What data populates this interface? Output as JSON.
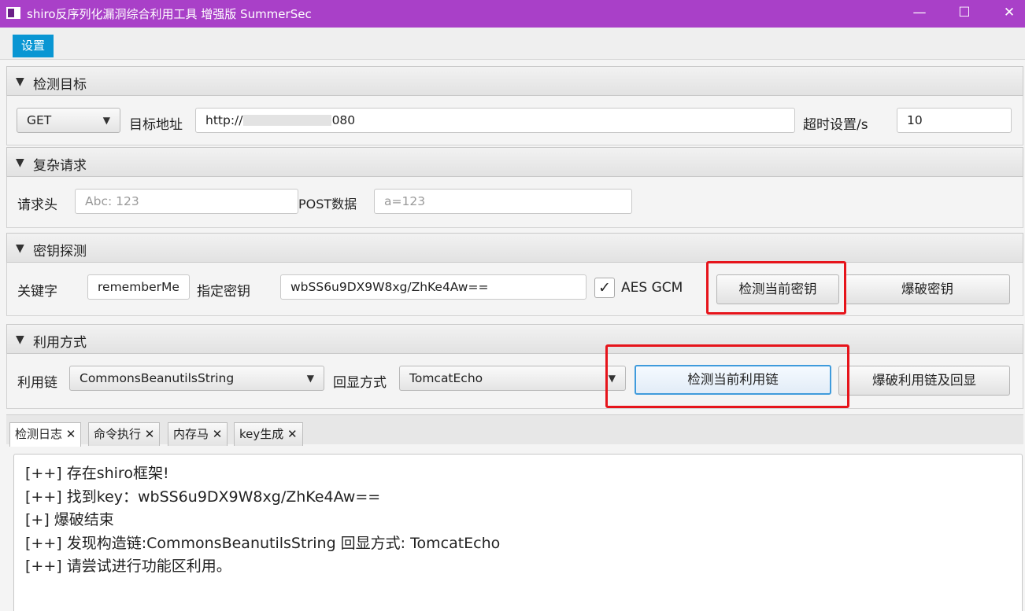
{
  "window": {
    "title": "shiro反序列化漏洞综合利用工具 增强版 SummerSec",
    "minimize": "—",
    "maximize": "☐",
    "close": "✕"
  },
  "menu": {
    "settings": "设置"
  },
  "target": {
    "header": "检测目标",
    "method": "GET",
    "url_label": "目标地址",
    "url_prefix": "http://",
    "url_suffix": ":8080",
    "timeout_label": "超时设置/s",
    "timeout_value": "10"
  },
  "complex": {
    "header": "复杂请求",
    "headers_label": "请求头",
    "headers_placeholder": "Abc: 123",
    "post_label": "POST数据",
    "post_placeholder": "a=123"
  },
  "key": {
    "header": "密钥探测",
    "keyword_label": "关键字",
    "keyword_value": "rememberMe",
    "key_label": "指定密钥",
    "key_value": "wbSS6u9DX9W8xg/ZhKe4Aw==",
    "aes_gcm_label": "AES GCM",
    "check_key_button": "检测当前密钥",
    "brute_key_button": "爆破密钥"
  },
  "exploit": {
    "header": "利用方式",
    "chain_label": "利用链",
    "chain_value": "CommonsBeanutilsString",
    "echo_label": "回显方式",
    "echo_value": "TomcatEcho",
    "check_chain_button": "检测当前利用链",
    "brute_chain_button": "爆破利用链及回显"
  },
  "tabs": [
    {
      "label": "检测日志"
    },
    {
      "label": "命令执行"
    },
    {
      "label": "内存马"
    },
    {
      "label": "key生成"
    }
  ],
  "log": [
    "[++] 存在shiro框架!",
    "[++] 找到key：wbSS6u9DX9W8xg/ZhKe4Aw==",
    "[+] 爆破结束",
    "[++] 发现构造链:CommonsBeanutilsString  回显方式: TomcatEcho",
    "[++] 请尝试进行功能区利用。"
  ]
}
